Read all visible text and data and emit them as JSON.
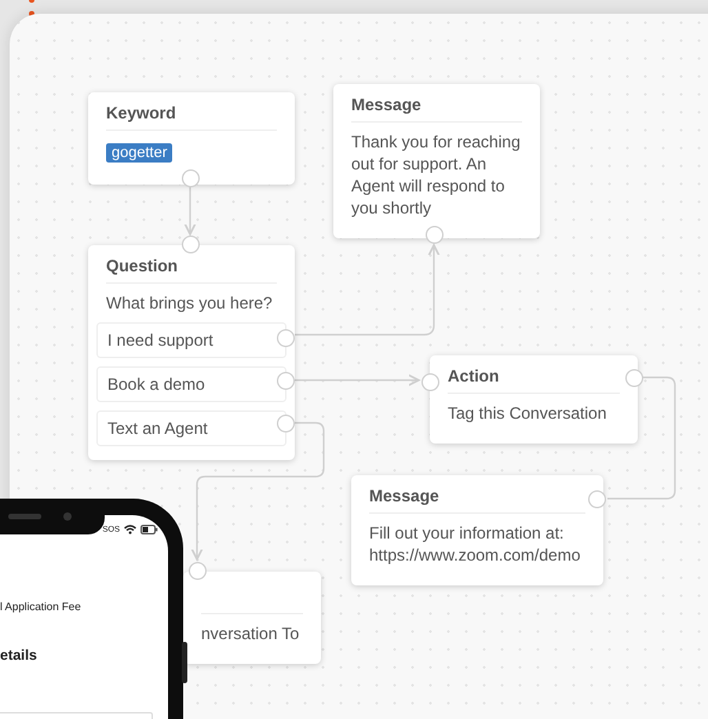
{
  "nodes": [
    {
      "kind": "keyword",
      "title": "Keyword",
      "tag": "gogetter"
    },
    {
      "kind": "message",
      "title": "Message",
      "text": "Thank you for reaching out for support. An Agent will respond to you shortly"
    },
    {
      "kind": "question",
      "title": "Question",
      "text": "What brings you here?",
      "options": [
        "I need support",
        "Book a demo",
        "Text an Agent"
      ]
    },
    {
      "kind": "action",
      "title": "Action",
      "text": "Tag this Conversation"
    },
    {
      "kind": "message",
      "title": "Message",
      "text": "Fill out your information at: https://www.zoom.com/demo"
    },
    {
      "kind": "action",
      "text": "nversation To"
    }
  ],
  "phone": {
    "status": "SOS",
    "line_1": "l Application Fee",
    "heading": "etails"
  }
}
